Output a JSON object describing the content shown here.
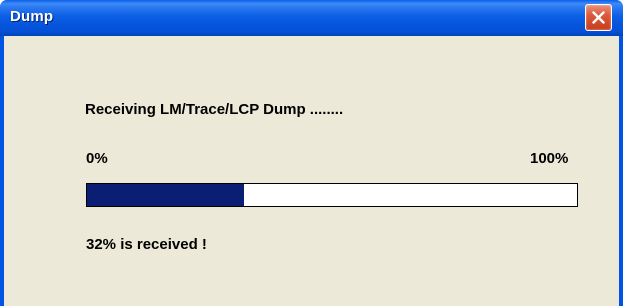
{
  "window": {
    "title": "Dump",
    "close_icon": "close-icon"
  },
  "dialog": {
    "message": "Receiving LM/Trace/LCP Dump ........",
    "min_label": "0%",
    "max_label": "100%",
    "progress_fraction": 0.32,
    "status_text": "32% is received !"
  },
  "colors": {
    "title_bar": "#0054e3",
    "client_background": "#ece9d8",
    "progress_fill": "#0a1e73",
    "close_button": "#db5a3a"
  }
}
